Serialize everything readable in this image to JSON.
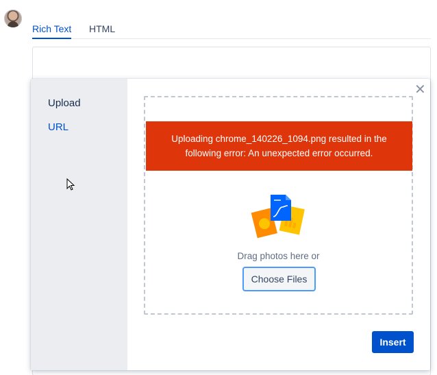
{
  "avatar": {
    "icon": "user-avatar"
  },
  "editor_tabs": [
    {
      "label": "Rich Text",
      "active": true
    },
    {
      "label": "HTML",
      "active": false
    }
  ],
  "modal": {
    "sidebar": {
      "items": [
        {
          "label": "Upload",
          "selected": true
        },
        {
          "label": "URL",
          "selected": false
        }
      ]
    },
    "close_icon": "close-icon",
    "error_message": "Uploading chrome_140226_1094.png resulted in the following error: An unexpected error occurred.",
    "drag_text": "Drag photos here or",
    "choose_files_label": "Choose Files",
    "insert_label": "Insert"
  },
  "colors": {
    "accent": "#0052cc",
    "error": "#de350b",
    "sidebar_bg": "#ebedf0",
    "focus": "#4c9aff"
  }
}
